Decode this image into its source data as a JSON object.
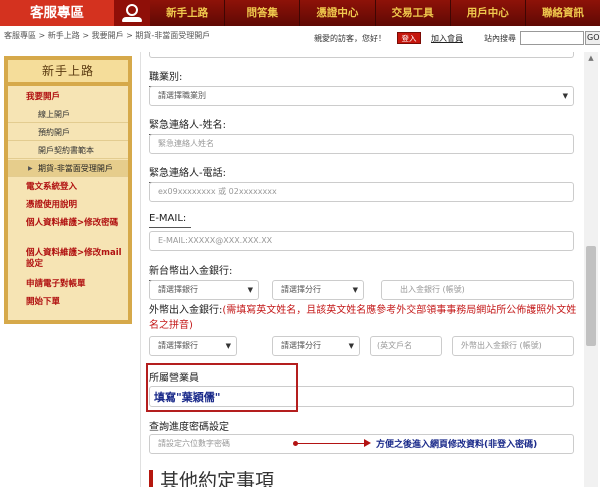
{
  "header": {
    "brand": "客服專區",
    "nav": [
      "新手上路",
      "問答集",
      "憑證中心",
      "交易工具",
      "用戶中心",
      "聯絡資訊"
    ]
  },
  "breadcrumb": "客服專區 > 新手上路 > 我要開戶 > 期貨-非當面受理開戶",
  "topbar": {
    "greeting": "親愛的訪客，您好！",
    "login": "登入",
    "join": "加入會員",
    "search_label": "站內搜尋",
    "go": "GO"
  },
  "sidebar": {
    "title": "新手上路",
    "items": [
      {
        "label": "我要開戶"
      },
      {
        "label": "線上開戶"
      },
      {
        "label": "預約開戶"
      },
      {
        "label": "開戶契約書範本"
      },
      {
        "label": "期貨-非當面受理開戶"
      },
      {
        "label": "電文系統登入"
      },
      {
        "label": "憑證使用說明"
      },
      {
        "label": "個人資料維護>修改密碼"
      },
      {
        "label": "個人資料維護>修改mail設定"
      },
      {
        "label": "申請電子對帳單"
      },
      {
        "label": "開始下單"
      }
    ]
  },
  "form": {
    "occupation_label": "職業別:",
    "occupation_select": "請選擇職業別",
    "contact_name_label": "緊急連絡人-姓名:",
    "contact_name_placeholder": "緊急連絡人姓名",
    "contact_phone_label": "緊急連絡人-電話:",
    "contact_phone_placeholder": "ex09xxxxxxxx 或 02xxxxxxxx",
    "email_label": "E-MAIL:",
    "email_placeholder": "E-MAIL:XXXXX@XXX.XXX.XX",
    "twd_label": "新台幣出入金銀行:",
    "bank_select": "請選擇銀行",
    "branch_select": "請選擇分行",
    "account_placeholder": "出入金銀行 (帳號)",
    "foreign_label": "外幣出入金銀行:",
    "foreign_note": "(需填寫英文姓名，且該英文姓名應參考外交部領事事務局網站所公佈護照外文姓名之拼音)",
    "english_name_placeholder": "(英文戶名",
    "foreign_account_placeholder": "外幣出入金銀行 (帳號)",
    "salesperson_label": "所屬營業員",
    "salesperson_note": "填寫\"葉穎儒\"",
    "password_label": "查詢進度密碼設定",
    "password_placeholder": "請設定六位數字密碼",
    "password_note": "方便之後進入網頁修改資料(非登入密碼)",
    "next_section": "其他約定事項"
  },
  "colors": {
    "brand_red": "#b5170e",
    "nav_gold": "#f0c94d",
    "sidebar_gold": "#d6a94a",
    "note_blue": "#1a2a8a"
  }
}
